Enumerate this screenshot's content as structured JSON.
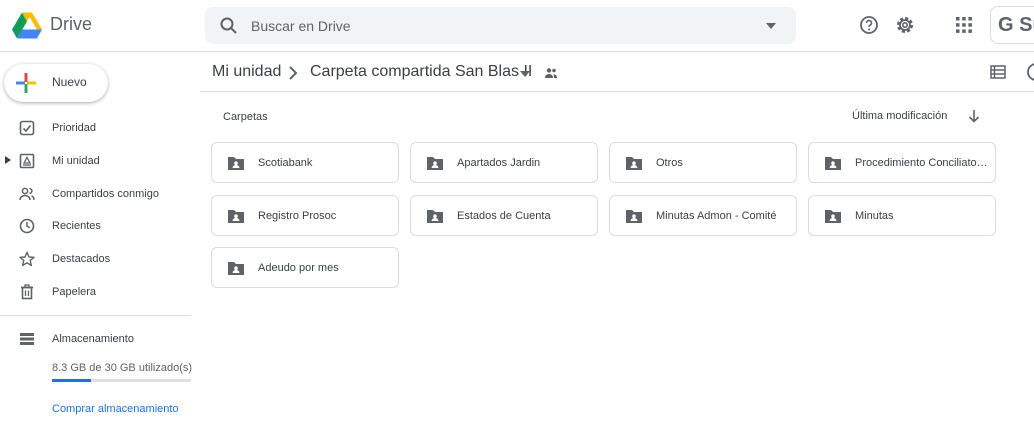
{
  "app": {
    "name": "Drive"
  },
  "search": {
    "placeholder": "Buscar en Drive"
  },
  "account": {
    "label": "G Su"
  },
  "sidebar": {
    "new_label": "Nuevo",
    "items": [
      {
        "label": "Prioridad",
        "icon": "priority-icon"
      },
      {
        "label": "Mi unidad",
        "icon": "my-drive-icon"
      },
      {
        "label": "Compartidos conmigo",
        "icon": "shared-with-me-icon"
      },
      {
        "label": "Recientes",
        "icon": "clock-icon"
      },
      {
        "label": "Destacados",
        "icon": "star-icon"
      },
      {
        "label": "Papelera",
        "icon": "trash-icon"
      },
      {
        "label": "Almacenamiento",
        "icon": "storage-icon"
      }
    ],
    "storage": {
      "usage": "8.3 GB de 30 GB utilizado(s)",
      "used_fraction": 0.277,
      "buy_label": "Comprar almacenamiento"
    }
  },
  "breadcrumb": {
    "root": "Mi unidad",
    "current": "Carpeta compartida San Blas II"
  },
  "main": {
    "section_title": "Carpetas",
    "sort_label": "Última modificación",
    "folders": [
      "Scotiabank",
      "Apartados Jardin",
      "Otros",
      "Procedimiento Conciliato…",
      "Registro Prosoc",
      "Estados de Cuenta",
      "Minutas Admon - Comité",
      "Minutas",
      "Adeudo por mes"
    ]
  },
  "colors": {
    "accent": "#1a73e8",
    "icon_gray": "#5f6368",
    "border": "#dadce0"
  }
}
